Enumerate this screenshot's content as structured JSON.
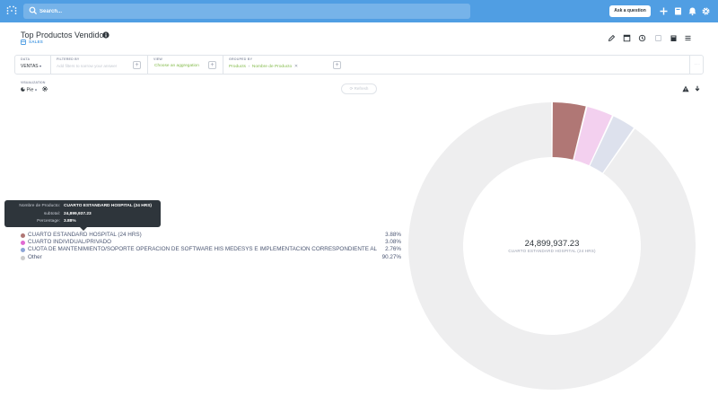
{
  "search": {
    "placeholder": "Search..."
  },
  "nav": {
    "ask_label": "Ask a question"
  },
  "question": {
    "title": "Top Productos Vendidos",
    "database": "SALES"
  },
  "builder": {
    "data_label": "DATA",
    "data_value": "VENTAS",
    "filter_label": "FILTERED BY",
    "filter_placeholder": "Add filters to narrow your answer",
    "view_label": "VIEW",
    "view_placeholder": "Choose an aggregation",
    "group_label": "GROUPED BY",
    "group_items": [
      "Products",
      "Nombre de Producto"
    ]
  },
  "viz": {
    "label": "VISUALIZATION",
    "type": "Pie",
    "refresh_label": "Refresh"
  },
  "tooltip": {
    "rows": [
      {
        "key": "Nombre de Producto:",
        "value": "CUARTO ESTANDARD HOSPITAL (24 HRS)"
      },
      {
        "key": "subtotal:",
        "value": "24,899,937.23"
      },
      {
        "key": "Percentage:",
        "value": "3.88%"
      }
    ]
  },
  "chart_data": {
    "type": "pie",
    "donut": true,
    "categories": [
      "CUARTO ESTANDARD HOSPITAL (24 HRS)",
      "CUARTO INDIVIDUAL/PRIVADO",
      "CUOTA DE MANTENIMIENTO/SOPORTE OPERACION DE SOFTWARE HIS MEDESYS E IMPLEMENTACION CORRESPONDIENTE AL",
      "Other"
    ],
    "values": [
      3.88,
      3.08,
      2.76,
      90.27
    ],
    "labels": [
      "3.88%",
      "3.08%",
      "2.76%",
      "90.27%"
    ],
    "colors": [
      "#b07775",
      "#f3d0ef",
      "#dde1ed",
      "#eeeeef"
    ],
    "legend_dot_colors": [
      "#b07775",
      "#e06ad2",
      "#8ea5d6",
      "#cccccc"
    ],
    "center_value": "24,899,937.23",
    "center_label": "CUARTO ESTANDARD HOSPITAL (24 HRS)"
  }
}
